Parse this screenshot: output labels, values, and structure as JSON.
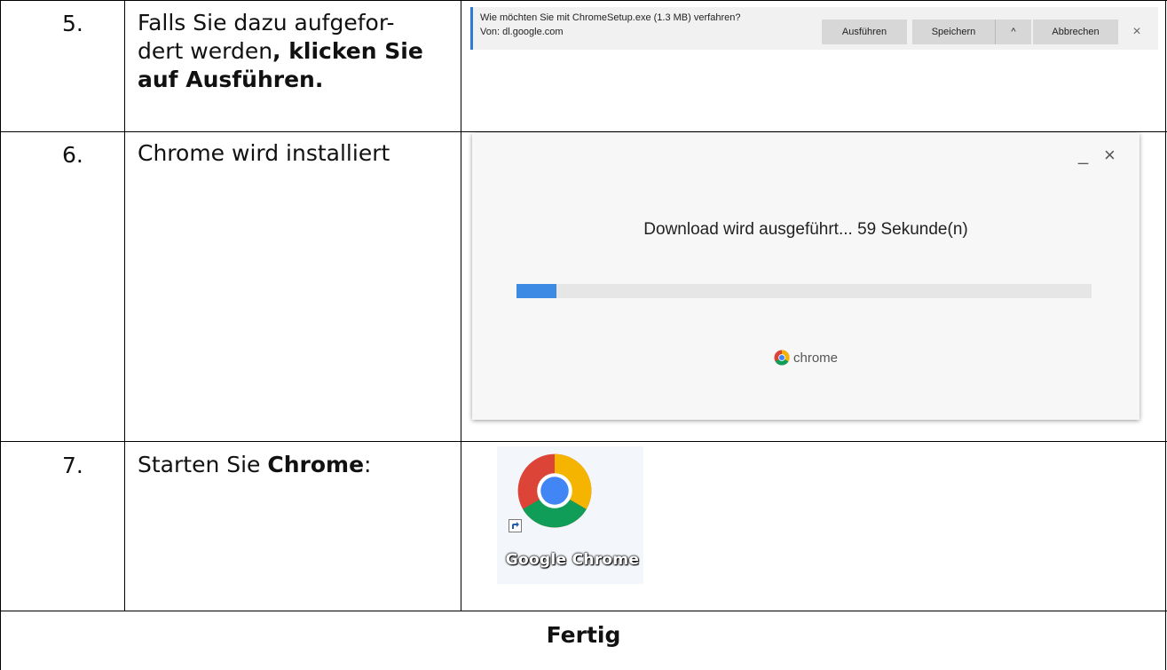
{
  "steps": [
    {
      "number": "5.",
      "text_plain": "Falls Sie dazu aufgefor-",
      "text_plain2": "dert werden",
      "text_bold": ", klicken Sie",
      "text_bold2": "auf Ausführen."
    },
    {
      "number": "6.",
      "text": "Chrome wird installiert"
    },
    {
      "number": "7.",
      "text_plain": "Starten Sie ",
      "text_bold": "Chrome",
      "text_suffix": ":"
    }
  ],
  "download_bar": {
    "question": "Wie möchten Sie mit ChromeSetup.exe (1.3 MB) verfahren?",
    "source": "Von: dl.google.com",
    "run_label": "Ausführen",
    "save_label": "Speichern",
    "expand_glyph": "^",
    "cancel_label": "Abbrechen",
    "close_glyph": "×"
  },
  "installer": {
    "minimize_glyph": "_",
    "close_glyph": "×",
    "message": "Download wird ausgeführt... 59 Sekunde(n)",
    "progress_percent": 7,
    "brand_label": "chrome",
    "accent": "#3c8ae4"
  },
  "desktop_icon": {
    "label": "Google Chrome"
  },
  "footer": {
    "text": "Fertig"
  }
}
